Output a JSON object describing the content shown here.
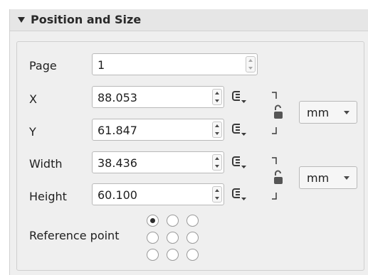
{
  "section": {
    "title": "Position and Size"
  },
  "page": {
    "label": "Page",
    "value": "1"
  },
  "x": {
    "label": "X",
    "value": "88.053"
  },
  "y": {
    "label": "Y",
    "value": "61.847"
  },
  "width": {
    "label": "Width",
    "value": "38.436"
  },
  "height": {
    "label": "Height",
    "value": "60.100"
  },
  "position_units": {
    "value": "mm"
  },
  "size_units": {
    "value": "mm"
  },
  "reference_point": {
    "label": "Reference point",
    "selected": "top-left",
    "options": [
      "top-left",
      "top-center",
      "top-right",
      "middle-left",
      "center",
      "middle-right",
      "bottom-left",
      "bottom-center",
      "bottom-right"
    ]
  },
  "icons": {
    "collapse": "triangle-down-icon",
    "data_defined": "data-defined-override-icon",
    "lock": "chain-lock-icon"
  }
}
